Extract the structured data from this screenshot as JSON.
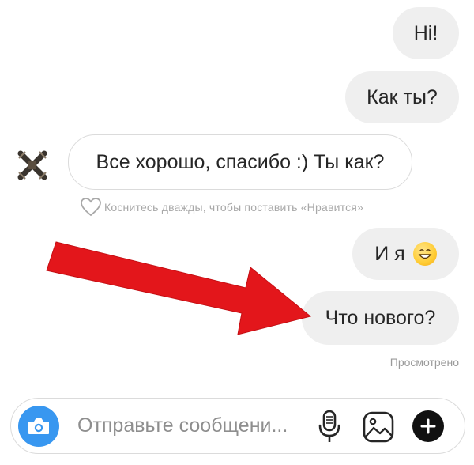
{
  "messages": {
    "hi": "Hi!",
    "kak_ty": "Как ты?",
    "vse_horosho": "Все хорошо, спасибо :) Ты как?",
    "i_ya": "И я",
    "chto_novogo": "Что нового?"
  },
  "hint": "Коснитесь дважды, чтобы поставить «Нравится»",
  "seen_status": "Просмотрено",
  "composer": {
    "placeholder": "Отправьте сообщени..."
  },
  "icons": {
    "avatar": "crossed-arrows-avatar",
    "like": "heart-icon",
    "emoji": "grinning-face-emoji",
    "camera": "camera-icon",
    "mic": "microphone-icon",
    "gallery": "gallery-icon",
    "add": "plus-icon",
    "annotation": "red-arrow"
  },
  "colors": {
    "outgoing_bubble": "#efefef",
    "incoming_border": "#dbdbdb",
    "camera_button": "#3897f0",
    "arrow": "#e3161b",
    "plus_button": "#111111"
  }
}
